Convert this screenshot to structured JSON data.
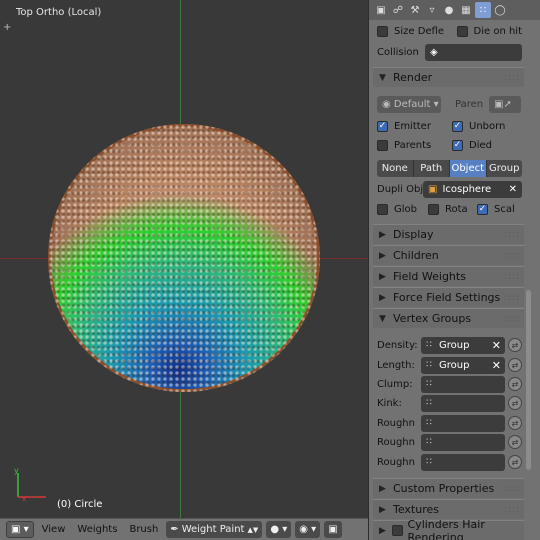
{
  "viewport": {
    "title": "Top Ortho (Local)",
    "object_label": "(0) Circle",
    "corner_plus": "+"
  },
  "header": {
    "mode_icon": "cube-icon",
    "menu": [
      "View",
      "Weights",
      "Brush"
    ],
    "mode": "Weight Paint",
    "mode_arrow": "▲▼"
  },
  "props": {
    "tabs": [
      "cube-icon",
      "link-icon",
      "wrench-icon",
      "vertex-icon",
      "material-icon",
      "texture-icon",
      "particles-icon",
      "physics-icon"
    ],
    "size_deflect": "Size Defle",
    "die_on_hit": "Die on hit",
    "collision_label": "Collision",
    "render": {
      "header": "Render",
      "material": "Default",
      "parent_label": "Paren",
      "emitter": "Emitter",
      "unborn": "Unborn",
      "parents": "Parents",
      "died": "Died",
      "types": [
        "None",
        "Path",
        "Object",
        "Group"
      ],
      "selected_type": "Object",
      "dupli_label": "Dupli Obj",
      "dupli_value": "Icosphere",
      "glob": "Glob",
      "rota": "Rota",
      "scal": "Scal"
    },
    "collapsed_panels": [
      "Display",
      "Children",
      "Field Weights",
      "Force Field Settings"
    ],
    "vertex_groups": {
      "header": "Vertex Groups",
      "rows": [
        {
          "label": "Density:",
          "value": "Group"
        },
        {
          "label": "Length:",
          "value": "Group"
        },
        {
          "label": "Clump:",
          "value": ""
        },
        {
          "label": "Kink:",
          "value": ""
        },
        {
          "label": "Roughn",
          "value": ""
        },
        {
          "label": "Roughn",
          "value": ""
        },
        {
          "label": "Roughn",
          "value": ""
        }
      ]
    },
    "bottom_panels": [
      "Custom Properties",
      "Textures",
      "Cylinders Hair Rendering"
    ]
  },
  "colors": {
    "selected_blue": "#5680c2",
    "checkbox_blue": "#3d6bb5",
    "panel_bg": "#727272",
    "viewport_bg": "#393939"
  }
}
